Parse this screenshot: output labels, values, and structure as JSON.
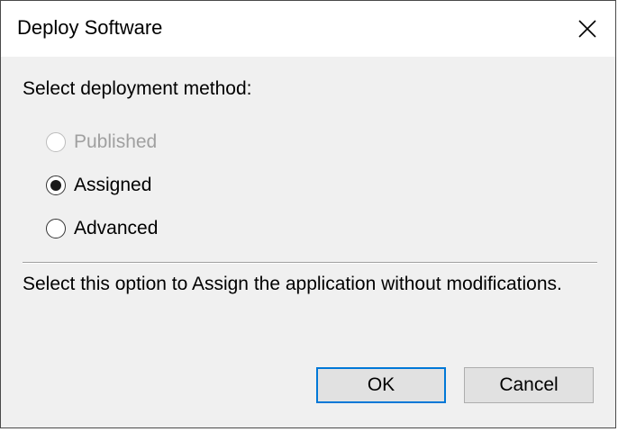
{
  "window": {
    "title": "Deploy Software"
  },
  "dialog": {
    "prompt": "Select deployment method:",
    "options": [
      {
        "label": "Published",
        "selected": false,
        "enabled": false
      },
      {
        "label": "Assigned",
        "selected": true,
        "enabled": true
      },
      {
        "label": "Advanced",
        "selected": false,
        "enabled": true
      }
    ],
    "description": "Select this option to Assign the application without modifications."
  },
  "buttons": {
    "ok_label": "OK",
    "cancel_label": "Cancel"
  },
  "colors": {
    "accent": "#0078d7",
    "background": "#f0f0f0",
    "disabled_text": "#a0a0a0"
  }
}
